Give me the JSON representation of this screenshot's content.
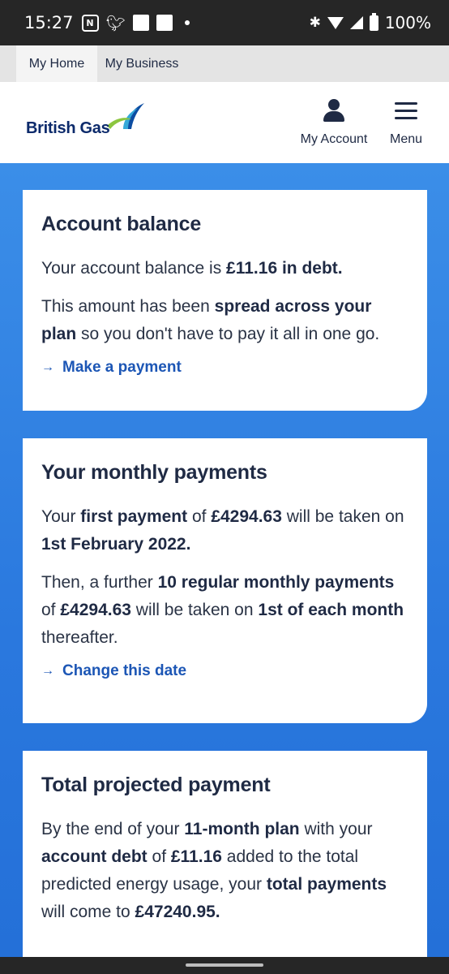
{
  "status_bar": {
    "time": "15:27",
    "battery": "100%",
    "icons": [
      "n-app-icon",
      "twitter-bird-icon",
      "square-notification-icon",
      "square-notification-icon",
      "dot-icon",
      "bluetooth-icon",
      "wifi-icon",
      "signal-icon",
      "battery-icon"
    ]
  },
  "segment_tabs": [
    "My Home",
    "My Business"
  ],
  "header": {
    "logo_text": "British Gas",
    "account_label": "My Account",
    "menu_label": "Menu"
  },
  "cards": {
    "balance": {
      "title": "Account balance",
      "line1_pre": "Your account balance is ",
      "line1_bold": "£11.16 in debt.",
      "line2_pre": "This amount has been ",
      "line2_bold": "spread across your plan",
      "line2_post": " so you don't have to pay it all in one go.",
      "link": "Make a payment"
    },
    "monthly": {
      "title": "Your monthly payments",
      "p1_a": "Your ",
      "p1_b": "first payment",
      "p1_c": " of ",
      "p1_d": "£4294.63",
      "p1_e": " will be taken on ",
      "p1_f": "1st February 2022.",
      "p2_a": "Then, a further ",
      "p2_b": "10 regular monthly payments",
      "p2_c": " of ",
      "p2_d": "£4294.63",
      "p2_e": " will be taken on ",
      "p2_f": "1st of each month",
      "p2_g": " thereafter.",
      "link": "Change this date"
    },
    "total": {
      "title": "Total projected payment",
      "p_a": "By the end of your ",
      "p_b": "11-month plan",
      "p_c": " with your ",
      "p_d": "account debt",
      "p_e": " of ",
      "p_f": "£11.16",
      "p_g": " added to the total predicted energy usage, your ",
      "p_h": "total payments",
      "p_i": " will come to ",
      "p_j": "£47240.95."
    }
  },
  "colors": {
    "background_blue": "#2a7be0",
    "brand_navy": "#0c2a6b",
    "link_blue": "#1c56b5",
    "text": "#1f2a44"
  }
}
